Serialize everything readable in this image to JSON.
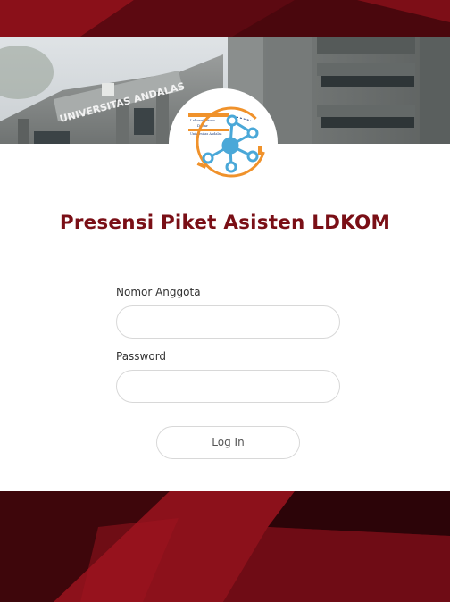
{
  "banner": {
    "building_sign": "UNIVERSITAS ANDALAS"
  },
  "logo": {
    "line1": "Laboratorium",
    "line2": "Dasar",
    "line3": "Universitas Andalas"
  },
  "form": {
    "title": "Presensi Piket Asisten LDKOM",
    "member_label": "Nomor Anggota",
    "member_value": "",
    "password_label": "Password",
    "password_value": "",
    "login_label": "Log In"
  },
  "colors": {
    "accent": "#7a0f16",
    "background_dark": "#5a0a12",
    "logo_orange": "#f0922b",
    "logo_blue": "#4aa8d8"
  }
}
